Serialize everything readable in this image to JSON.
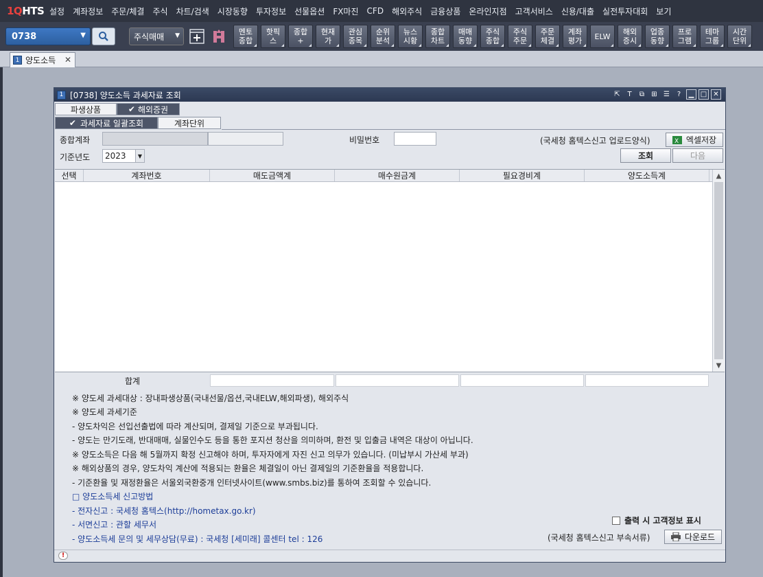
{
  "app": {
    "logo_a": "1Q",
    "logo_b": "HTS"
  },
  "menu": [
    "설정",
    "계좌정보",
    "주문/체결",
    "주식",
    "차트/검색",
    "시장동향",
    "투자정보",
    "선물옵션",
    "FX마진",
    "CFD",
    "해외주식",
    "금융상품",
    "온라인지점",
    "고객서비스",
    "신용/대출",
    "실전투자대회",
    "보기"
  ],
  "toolbar": {
    "code": "0738",
    "mode": "주식매매",
    "buttons": [
      [
        "멘토",
        "종합"
      ],
      [
        "핫픽",
        "스"
      ],
      [
        "종합",
        "+"
      ],
      [
        "현재",
        "가"
      ],
      [
        "관심",
        "종목"
      ],
      [
        "순위",
        "분석"
      ],
      [
        "뉴스",
        "시황"
      ],
      [
        "종합",
        "차트"
      ],
      [
        "매매",
        "동향"
      ],
      [
        "주식",
        "종합"
      ],
      [
        "주식",
        "주문"
      ],
      [
        "주문",
        "체결"
      ],
      [
        "계좌",
        "평가"
      ],
      [
        "ELW",
        ""
      ],
      [
        "해외",
        "증시"
      ],
      [
        "업종",
        "동향"
      ],
      [
        "프로",
        "그램"
      ],
      [
        "테마",
        "그룹"
      ],
      [
        "시간",
        "단위"
      ]
    ]
  },
  "tab": {
    "num": "1",
    "label": "양도소득"
  },
  "window": {
    "num": "1",
    "title": "[0738] 양도소득 과세자료 조회",
    "tabs1": {
      "a": "파생상품",
      "b": "해외증권"
    },
    "tabs2": {
      "a": "과세자료 일괄조회",
      "b": "계좌단위"
    },
    "form": {
      "account_label": "종합계좌",
      "password_label": "비밀번호",
      "year_label": "기준년도",
      "year_value": "2023",
      "hometax_note": "(국세청 홈텍스신고 업로드양식)",
      "excel_button": "엑셀저장",
      "search_button": "조회",
      "next_button": "다음"
    },
    "grid": {
      "columns": [
        "선택",
        "계좌번호",
        "매도금액계",
        "매수원금계",
        "필요경비계",
        "양도소득계"
      ],
      "rows": []
    },
    "total_label": "합계",
    "notes": [
      "※ 양도세 과세대상 : 장내파생상품(국내선물/옵션,국내ELW,해외파생), 해외주식",
      "※ 양도세 과세기준",
      " - 양도차익은 선입선출법에 따라 계산되며, 결제일 기준으로 부과됩니다.",
      " - 양도는 만기도래, 반대매매, 실물인수도 등을 통한 포지션 청산을 의미하며, 환전 및 입출금 내역은 대상이 아닙니다.",
      "※ 양도소득은 다음 해 5월까지 확정 신고해야 하며, 투자자에게 자진 신고 의무가 있습니다. (미납부시 가산세 부과)",
      "※ 해외상품의 경우, 양도차익 계산에 적용되는 환율은 체결일이 아닌 결제일의 기준환율을 적용합니다.",
      " - 기준환율 및 재정환율은 서울외국환중개 인터넷사이트(www.smbs.biz)를 통하여 조회할 수 있습니다.",
      "□ 양도소득세 신고방법",
      " - 전자신고 : 국세청 홈텍스(http://hometax.go.kr)",
      " - 서면신고 : 관할 세무서",
      " - 양도소득세 문의 및 세무상담(무료) : 국세청 [세미래] 콜센터 tel : 126"
    ],
    "print_option": "출력 시 고객정보 표시",
    "attach_note": "(국세청 홈텍스신고 부속서류)",
    "download_button": "다운로드"
  }
}
